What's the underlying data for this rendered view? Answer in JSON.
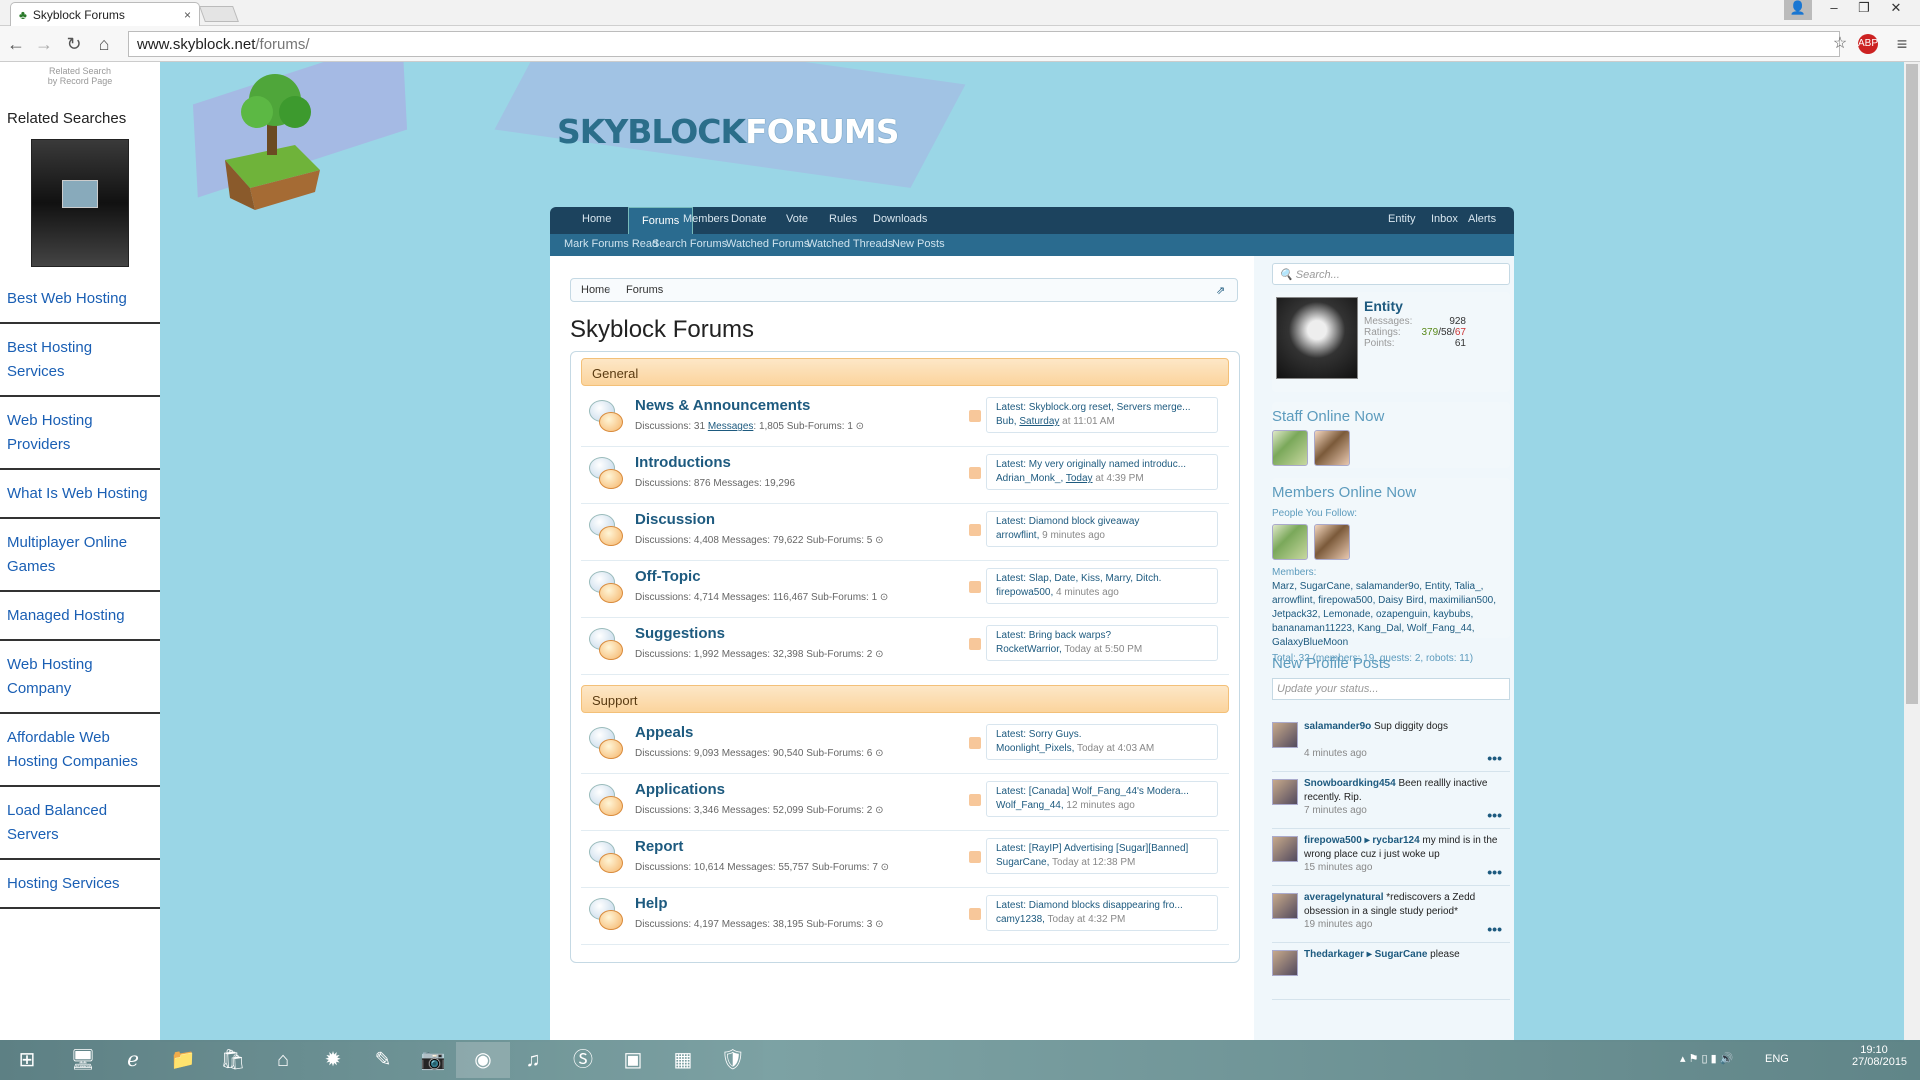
{
  "browser": {
    "tab_title": "Skyblock Forums",
    "url_host": "www.skyblock.net",
    "url_path": "/forums/",
    "tab_close": "×",
    "win_min": "‒",
    "win_max": "❐",
    "win_close": "✕"
  },
  "ads": {
    "small_line1": "Related Search",
    "small_line2": "by Record Page",
    "heading": "Related Searches",
    "links": [
      "Best Web Hosting",
      "Best Hosting Services",
      "Web Hosting Providers",
      "What Is Web Hosting",
      "Multiplayer Online Games",
      "Managed Hosting",
      "Web Hosting Company",
      "Affordable Web Hosting Companies",
      "Load Balanced Servers",
      "Hosting Services"
    ]
  },
  "site": {
    "logo_a": "SKYBLOCK",
    "logo_b": "FORUMS"
  },
  "nav": {
    "tabs": [
      "Home",
      "Forums",
      "Members",
      "Donate",
      "Vote",
      "Rules",
      "Downloads"
    ],
    "right": [
      "Entity",
      "Inbox",
      "Alerts"
    ],
    "sub": [
      "Mark Forums Read",
      "Search Forums",
      "Watched Forums",
      "Watched Threads",
      "New Posts"
    ]
  },
  "breadcrumb": [
    "Home",
    "Forums"
  ],
  "page_title": "Skyblock Forums",
  "categories": [
    {
      "name": "General",
      "forums": [
        {
          "title": "News & Announcements",
          "stats": "Discussions: 31 ",
          "stats_link": "Messages",
          "stats_rest": ": 1,805   Sub-Forums: 1 ⊙",
          "latest": "Latest: Skyblock.org reset, Servers merge...",
          "user": "Bub, ",
          "time_link": "Saturday",
          "time": " at 11:01 AM"
        },
        {
          "title": "Introductions",
          "stats": "Discussions: 876  Messages: 19,296",
          "stats_link": "",
          "stats_rest": "",
          "latest": "Latest: My very originally named introduc...",
          "user": "Adrian_Monk_, ",
          "time_link": "Today",
          "time": " at 4:39 PM"
        },
        {
          "title": "Discussion",
          "stats": "Discussions: 4,408  Messages: 79,622   Sub-Forums: 5 ⊙",
          "stats_link": "",
          "stats_rest": "",
          "latest": "Latest: Diamond block giveaway",
          "user": "arrowflint, ",
          "time_link": "",
          "time": "9 minutes ago"
        },
        {
          "title": "Off-Topic",
          "stats": "Discussions: 4,714  Messages: 116,467   Sub-Forums: 1 ⊙",
          "stats_link": "",
          "stats_rest": "",
          "latest": "Latest: Slap, Date, Kiss, Marry, Ditch.",
          "user": "firepowa500, ",
          "time_link": "",
          "time": "4 minutes ago"
        },
        {
          "title": "Suggestions",
          "stats": "Discussions: 1,992  Messages: 32,398   Sub-Forums: 2 ⊙",
          "stats_link": "",
          "stats_rest": "",
          "latest": "Latest: Bring back warps?",
          "user": "RocketWarrior, ",
          "time_link": "",
          "time": "Today at 5:50 PM"
        }
      ]
    },
    {
      "name": "Support",
      "forums": [
        {
          "title": "Appeals",
          "stats": "Discussions: 9,093  Messages: 90,540   Sub-Forums: 6 ⊙",
          "stats_link": "",
          "stats_rest": "",
          "latest": "Latest: Sorry Guys.",
          "user": "Moonlight_Pixels, ",
          "time_link": "",
          "time": "Today at 4:03 AM"
        },
        {
          "title": "Applications",
          "stats": "Discussions: 3,346  Messages: 52,099   Sub-Forums: 2 ⊙",
          "stats_link": "",
          "stats_rest": "",
          "latest": "Latest: [Canada] Wolf_Fang_44's Modera...",
          "user": "Wolf_Fang_44, ",
          "time_link": "",
          "time": "12 minutes ago"
        },
        {
          "title": "Report",
          "stats": "Discussions: 10,614  Messages: 55,757   Sub-Forums: 7 ⊙",
          "stats_link": "",
          "stats_rest": "",
          "latest": "Latest: [RayIP] Advertising [Sugar][Banned]",
          "user": "SugarCane, ",
          "time_link": "",
          "time": "Today at 12:38 PM"
        },
        {
          "title": "Help",
          "stats": "Discussions: 4,197  Messages: 38,195   Sub-Forums: 3 ⊙",
          "stats_link": "",
          "stats_rest": "",
          "latest": "Latest: Diamond blocks disappearing fro...",
          "user": "camy1238, ",
          "time_link": "",
          "time": "Today at 4:32 PM"
        }
      ]
    }
  ],
  "sidebar": {
    "search_placeholder": "Search...",
    "user": {
      "name": "Entity",
      "messages_label": "Messages:",
      "messages": "928",
      "ratings_label": "Ratings:",
      "ratings_pos": "379",
      "ratings_neu": "/58/",
      "ratings_neg": "67",
      "points_label": "Points:",
      "points": "61"
    },
    "staff_head": "Staff Online Now",
    "members_head": "Members Online Now",
    "follow_label": "People You Follow:",
    "members_label": "Members:",
    "members_list": "Marz, SugarCane, salamander9o, Entity, Talia_, arrowflint, firepowa500, Daisy Bird, maximilian500, Jetpack32, Lemonade, ozapenguin, kaybubs, bananaman11223, Kang_Dal, Wolf_Fang_44, GalaxyBlueMoon",
    "totals": "Total: 32 (members: 19, guests: 2, robots: 11)",
    "profile_head": "New Profile Posts",
    "status_placeholder": "Update your status...",
    "posts": [
      {
        "user": "salamander9o",
        "text": " Sup diggity dogs",
        "time": "4 minutes ago"
      },
      {
        "user": "Snowboardking454",
        "text": " Been reallly inactive recently. Rip.",
        "time": "7 minutes ago"
      },
      {
        "user": "firepowa500 ▸ rycbar124",
        "text": " my mind is in the wrong place cuz i just woke up",
        "time": "15 minutes ago"
      },
      {
        "user": "averagelynatural",
        "text": " *rediscovers a Zedd obsession in a single study period*",
        "time": "19 minutes ago"
      },
      {
        "user": "Thedarkager ▸ SugarCane",
        "text": " please",
        "time": ""
      }
    ]
  },
  "taskbar": {
    "lang": "ENG",
    "time": "19:10",
    "date": "27/08/2015"
  }
}
